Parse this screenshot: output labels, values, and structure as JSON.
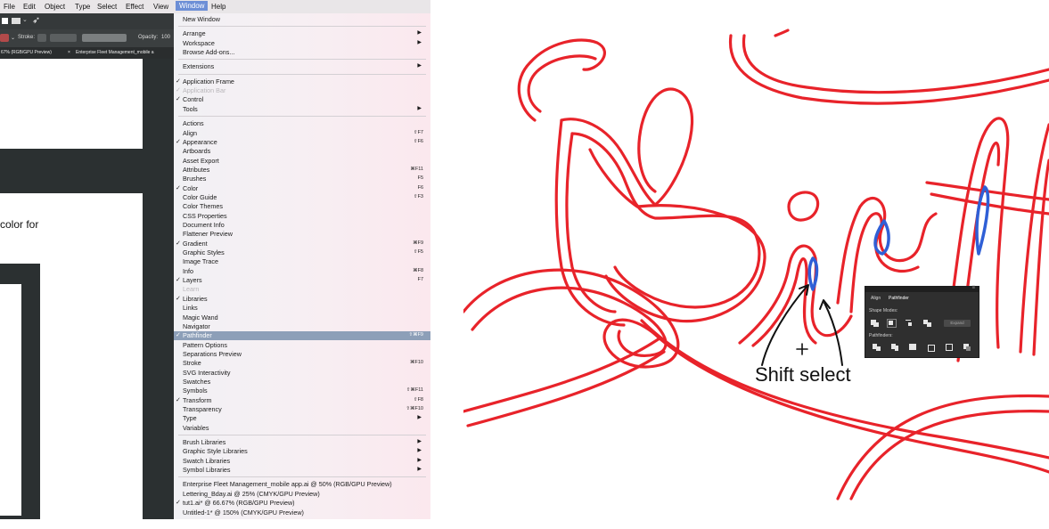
{
  "menubar": {
    "items": [
      "File",
      "Edit",
      "Object",
      "Type",
      "Select",
      "Effect",
      "View",
      "Window",
      "Help"
    ],
    "active": "Window"
  },
  "control_bar": {
    "stroke_label": "Stroke:",
    "opacity_label": "Opacity:",
    "opacity_value": "100"
  },
  "doc_tabs": {
    "active": "67% (RGB/GPU Preview)",
    "other": "Enterprise Fleet Management_mobile a"
  },
  "doc_text": "color for",
  "window_menu": {
    "items": [
      {
        "label": "New Window",
        "checked": false,
        "shortcut": "",
        "submenu": false,
        "disabled": false
      },
      {
        "sep": true
      },
      {
        "label": "Arrange",
        "checked": false,
        "shortcut": "",
        "submenu": true,
        "disabled": false
      },
      {
        "label": "Workspace",
        "checked": false,
        "shortcut": "",
        "submenu": true,
        "disabled": false
      },
      {
        "label": "Browse Add-ons...",
        "checked": false,
        "shortcut": "",
        "submenu": false,
        "disabled": false
      },
      {
        "sep": true
      },
      {
        "label": "Extensions",
        "checked": false,
        "shortcut": "",
        "submenu": true,
        "disabled": false
      },
      {
        "sep": true
      },
      {
        "label": "Application Frame",
        "checked": true,
        "shortcut": "",
        "submenu": false,
        "disabled": false
      },
      {
        "label": "Application Bar",
        "checked": true,
        "shortcut": "",
        "submenu": false,
        "disabled": true
      },
      {
        "label": "Control",
        "checked": true,
        "shortcut": "",
        "submenu": false,
        "disabled": false
      },
      {
        "label": "Tools",
        "checked": false,
        "shortcut": "",
        "submenu": true,
        "disabled": false
      },
      {
        "sep": true
      },
      {
        "label": "Actions",
        "checked": false,
        "shortcut": "",
        "submenu": false,
        "disabled": false
      },
      {
        "label": "Align",
        "checked": false,
        "shortcut": "⇧F7",
        "submenu": false,
        "disabled": false
      },
      {
        "label": "Appearance",
        "checked": true,
        "shortcut": "⇧F6",
        "submenu": false,
        "disabled": false
      },
      {
        "label": "Artboards",
        "checked": false,
        "shortcut": "",
        "submenu": false,
        "disabled": false
      },
      {
        "label": "Asset Export",
        "checked": false,
        "shortcut": "",
        "submenu": false,
        "disabled": false
      },
      {
        "label": "Attributes",
        "checked": false,
        "shortcut": "⌘F11",
        "submenu": false,
        "disabled": false
      },
      {
        "label": "Brushes",
        "checked": false,
        "shortcut": "F5",
        "submenu": false,
        "disabled": false
      },
      {
        "label": "Color",
        "checked": true,
        "shortcut": "F6",
        "submenu": false,
        "disabled": false
      },
      {
        "label": "Color Guide",
        "checked": false,
        "shortcut": "⇧F3",
        "submenu": false,
        "disabled": false
      },
      {
        "label": "Color Themes",
        "checked": false,
        "shortcut": "",
        "submenu": false,
        "disabled": false
      },
      {
        "label": "CSS Properties",
        "checked": false,
        "shortcut": "",
        "submenu": false,
        "disabled": false
      },
      {
        "label": "Document Info",
        "checked": false,
        "shortcut": "",
        "submenu": false,
        "disabled": false
      },
      {
        "label": "Flattener Preview",
        "checked": false,
        "shortcut": "",
        "submenu": false,
        "disabled": false
      },
      {
        "label": "Gradient",
        "checked": true,
        "shortcut": "⌘F9",
        "submenu": false,
        "disabled": false
      },
      {
        "label": "Graphic Styles",
        "checked": false,
        "shortcut": "⇧F5",
        "submenu": false,
        "disabled": false
      },
      {
        "label": "Image Trace",
        "checked": false,
        "shortcut": "",
        "submenu": false,
        "disabled": false
      },
      {
        "label": "Info",
        "checked": false,
        "shortcut": "⌘F8",
        "submenu": false,
        "disabled": false
      },
      {
        "label": "Layers",
        "checked": true,
        "shortcut": "F7",
        "submenu": false,
        "disabled": false
      },
      {
        "label": "Learn",
        "checked": false,
        "shortcut": "",
        "submenu": false,
        "disabled": true
      },
      {
        "label": "Libraries",
        "checked": true,
        "shortcut": "",
        "submenu": false,
        "disabled": false
      },
      {
        "label": "Links",
        "checked": false,
        "shortcut": "",
        "submenu": false,
        "disabled": false
      },
      {
        "label": "Magic Wand",
        "checked": false,
        "shortcut": "",
        "submenu": false,
        "disabled": false
      },
      {
        "label": "Navigator",
        "checked": false,
        "shortcut": "",
        "submenu": false,
        "disabled": false
      },
      {
        "label": "Pathfinder",
        "checked": true,
        "shortcut": "⇧⌘F9",
        "submenu": false,
        "disabled": false,
        "highlighted": true
      },
      {
        "label": "Pattern Options",
        "checked": false,
        "shortcut": "",
        "submenu": false,
        "disabled": false
      },
      {
        "label": "Separations Preview",
        "checked": false,
        "shortcut": "",
        "submenu": false,
        "disabled": false
      },
      {
        "label": "Stroke",
        "checked": false,
        "shortcut": "⌘F10",
        "submenu": false,
        "disabled": false
      },
      {
        "label": "SVG Interactivity",
        "checked": false,
        "shortcut": "",
        "submenu": false,
        "disabled": false
      },
      {
        "label": "Swatches",
        "checked": false,
        "shortcut": "",
        "submenu": false,
        "disabled": false
      },
      {
        "label": "Symbols",
        "checked": false,
        "shortcut": "⇧⌘F11",
        "submenu": false,
        "disabled": false
      },
      {
        "label": "Transform",
        "checked": true,
        "shortcut": "⇧F8",
        "submenu": false,
        "disabled": false
      },
      {
        "label": "Transparency",
        "checked": false,
        "shortcut": "⇧⌘F10",
        "submenu": false,
        "disabled": false
      },
      {
        "label": "Type",
        "checked": false,
        "shortcut": "",
        "submenu": true,
        "disabled": false
      },
      {
        "label": "Variables",
        "checked": false,
        "shortcut": "",
        "submenu": false,
        "disabled": false
      },
      {
        "sep": true
      },
      {
        "label": "Brush Libraries",
        "checked": false,
        "shortcut": "",
        "submenu": true,
        "disabled": false
      },
      {
        "label": "Graphic Style Libraries",
        "checked": false,
        "shortcut": "",
        "submenu": true,
        "disabled": false
      },
      {
        "label": "Swatch Libraries",
        "checked": false,
        "shortcut": "",
        "submenu": true,
        "disabled": false
      },
      {
        "label": "Symbol Libraries",
        "checked": false,
        "shortcut": "",
        "submenu": true,
        "disabled": false
      },
      {
        "sep": true
      },
      {
        "label": "Enterprise Fleet Management_mobile app.ai @ 50% (RGB/GPU Preview)",
        "checked": false,
        "shortcut": "",
        "submenu": false,
        "disabled": false
      },
      {
        "label": "Lettering_Bday.ai @ 25% (CMYK/GPU Preview)",
        "checked": false,
        "shortcut": "",
        "submenu": false,
        "disabled": false
      },
      {
        "label": "tut1.ai* @ 66.67% (RGB/GPU Preview)",
        "checked": true,
        "shortcut": "",
        "submenu": false,
        "disabled": false
      },
      {
        "label": "Untitled-1* @ 150% (CMYK/GPU Preview)",
        "checked": false,
        "shortcut": "",
        "submenu": false,
        "disabled": false
      }
    ]
  },
  "pathfinder_panel": {
    "tab_align": "Align",
    "tab_pathfinder": "Pathfinder",
    "shape_modes_label": "Shape Modes:",
    "pathfinders_label": "Pathfinders:",
    "expand_label": "Expand"
  },
  "annotation": {
    "label": "Shift select",
    "cursor": "+"
  },
  "colors": {
    "stroke_red": "#e8232a",
    "selected_blue": "#2f5fd6",
    "menu_highlight": "#8d9fb8"
  }
}
